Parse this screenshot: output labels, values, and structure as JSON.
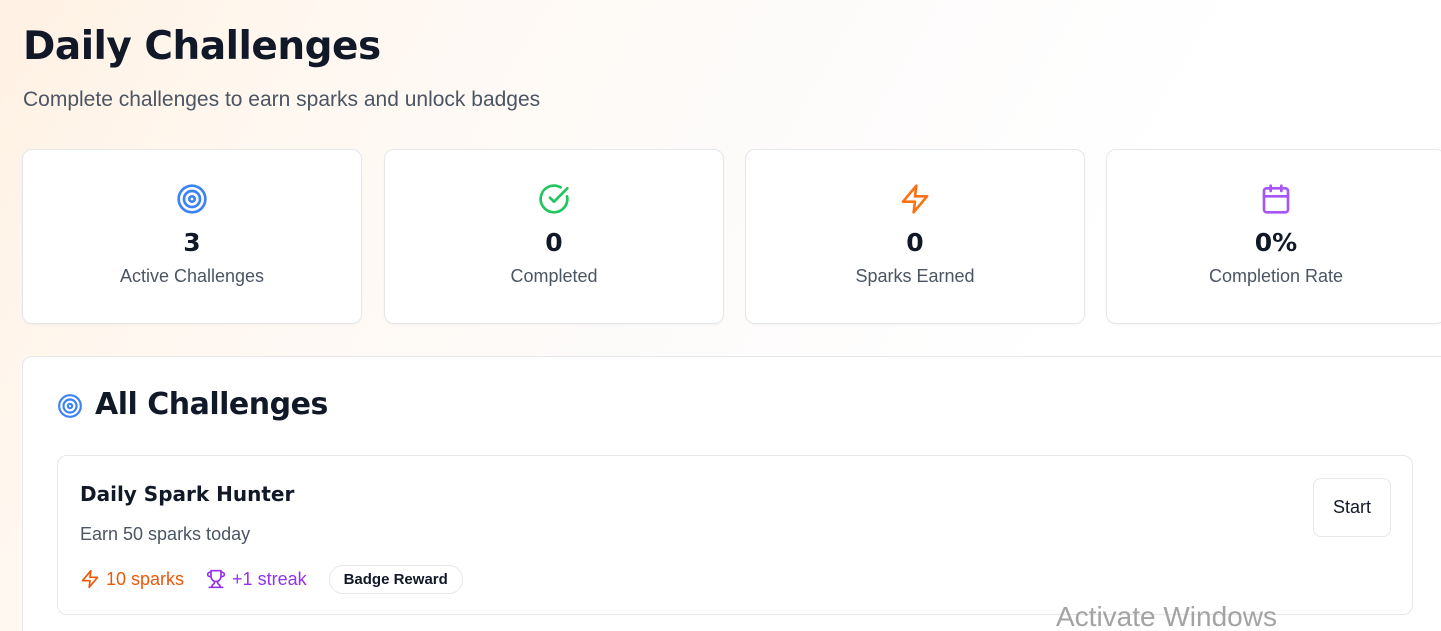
{
  "header": {
    "title": "Daily Challenges",
    "subtitle": "Complete challenges to earn sparks and unlock badges"
  },
  "stats": [
    {
      "icon": "target-icon",
      "value": "3",
      "label": "Active Challenges",
      "color": "#3b82f6"
    },
    {
      "icon": "check-circle-icon",
      "value": "0",
      "label": "Completed",
      "color": "#22c55e"
    },
    {
      "icon": "lightning-icon",
      "value": "0",
      "label": "Sparks Earned",
      "color": "#f97316"
    },
    {
      "icon": "calendar-icon",
      "value": "0%",
      "label": "Completion Rate",
      "color": "#a855f7"
    }
  ],
  "panel": {
    "title": "All Challenges",
    "icon": "target-icon"
  },
  "challenges": [
    {
      "title": "Daily Spark Hunter",
      "description": "Earn 50 sparks today",
      "sparks": "10 sparks",
      "streak": "+1 streak",
      "badge": "Badge Reward",
      "action": "Start"
    }
  ],
  "watermark": "Activate Windows",
  "colors": {
    "accent_blue": "#3b82f6",
    "success_green": "#22c55e",
    "spark_orange": "#ea580c",
    "streak_purple": "#9333ea"
  }
}
